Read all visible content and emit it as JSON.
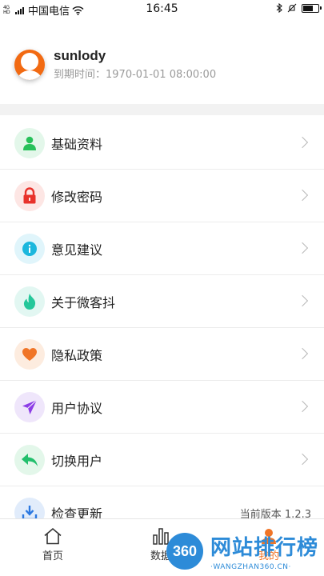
{
  "status_bar": {
    "signal_prefix": "4G\nHD",
    "carrier": "中国电信",
    "time": "16:45"
  },
  "profile": {
    "username": "sunlody",
    "expire_label": "到期时间：",
    "expire_value": "1970-01-01 08:00:00"
  },
  "menu": {
    "items": [
      {
        "label": "基础资料",
        "icon": "user-icon",
        "bg": "#e3f7ea",
        "fg": "#27c15a"
      },
      {
        "label": "修改密码",
        "icon": "lock-icon",
        "bg": "#fde6e4",
        "fg": "#e8322b"
      },
      {
        "label": "意见建议",
        "icon": "info-icon",
        "bg": "#e0f5fb",
        "fg": "#1cb7dd"
      },
      {
        "label": "关于微客抖",
        "icon": "flame-icon",
        "bg": "#e2f7f2",
        "fg": "#24c79a"
      },
      {
        "label": "隐私政策",
        "icon": "heart-icon",
        "bg": "#fdecdf",
        "fg": "#f07527"
      },
      {
        "label": "用户协议",
        "icon": "paper-plane-icon",
        "bg": "#efe6fb",
        "fg": "#8c3de6"
      },
      {
        "label": "切换用户",
        "icon": "reply-arrow-icon",
        "bg": "#e3f7ea",
        "fg": "#22bf6c"
      },
      {
        "label": "检查更新",
        "icon": "download-icon",
        "bg": "#e1ecfb",
        "fg": "#2b78e0",
        "value": "当前版本 1.2.3"
      }
    ]
  },
  "bottom_nav": {
    "home": "首页",
    "data": "数据",
    "mine": "我的"
  },
  "watermark": {
    "logo": "360",
    "title": "网站排行榜",
    "subtitle": "·WANGZHAN360.CN·"
  }
}
